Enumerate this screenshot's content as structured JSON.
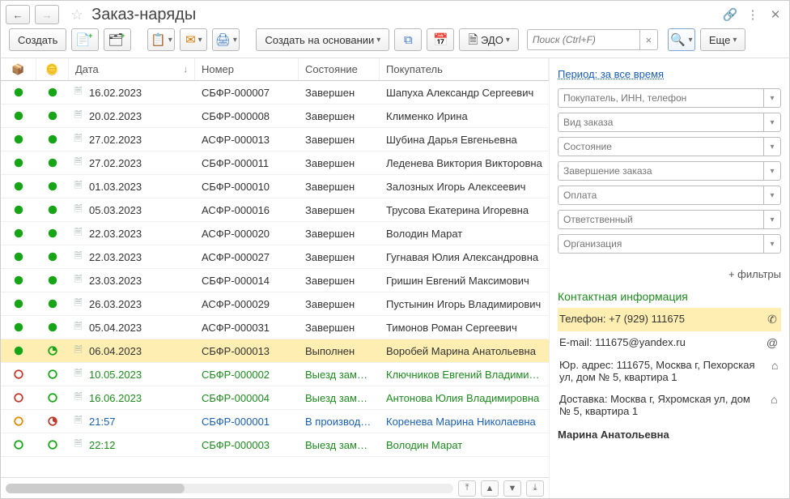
{
  "header": {
    "title": "Заказ-наряды"
  },
  "toolbar": {
    "create": "Создать",
    "create_based": "Создать на основании",
    "edo": "ЭДО",
    "search_placeholder": "Поиск (Ctrl+F)",
    "more": "Еще"
  },
  "table": {
    "columns": {
      "date": "Дата",
      "number": "Номер",
      "state": "Состояние",
      "buyer": "Покупатель"
    },
    "rows": [
      {
        "s1": "filled-green",
        "s2": "filled-green",
        "date": "16.02.2023",
        "num": "СБФР-000007",
        "state": "Завершен",
        "buyer": "Шапуха Александр Сергеевич"
      },
      {
        "s1": "filled-green",
        "s2": "filled-green",
        "date": "20.02.2023",
        "num": "СБФР-000008",
        "state": "Завершен",
        "buyer": "Клименко Ирина"
      },
      {
        "s1": "filled-green",
        "s2": "filled-green",
        "date": "27.02.2023",
        "num": "АСФР-000013",
        "state": "Завершен",
        "buyer": "Шубина Дарья Евгеньевна"
      },
      {
        "s1": "filled-green",
        "s2": "filled-green",
        "date": "27.02.2023",
        "num": "СБФР-000011",
        "state": "Завершен",
        "buyer": "Леденева Виктория Викторовна"
      },
      {
        "s1": "filled-green",
        "s2": "filled-green",
        "date": "01.03.2023",
        "num": "СБФР-000010",
        "state": "Завершен",
        "buyer": "Залозных Игорь Алексеевич"
      },
      {
        "s1": "filled-green",
        "s2": "filled-green",
        "date": "05.03.2023",
        "num": "АСФР-000016",
        "state": "Завершен",
        "buyer": "Трусова Екатерина Игоревна"
      },
      {
        "s1": "filled-green",
        "s2": "filled-green",
        "date": "22.03.2023",
        "num": "АСФР-000020",
        "state": "Завершен",
        "buyer": "Володин Марат"
      },
      {
        "s1": "filled-green",
        "s2": "filled-green",
        "date": "22.03.2023",
        "num": "АСФР-000027",
        "state": "Завершен",
        "buyer": "Гугнавая Юлия Александровна"
      },
      {
        "s1": "filled-green",
        "s2": "filled-green",
        "date": "23.03.2023",
        "num": "СБФР-000014",
        "state": "Завершен",
        "buyer": "Гришин Евгений Максимович"
      },
      {
        "s1": "filled-green",
        "s2": "filled-green",
        "date": "26.03.2023",
        "num": "АСФР-000029",
        "state": "Завершен",
        "buyer": "Пустынин Игорь Владимирович"
      },
      {
        "s1": "filled-green",
        "s2": "filled-green",
        "date": "05.04.2023",
        "num": "АСФР-000031",
        "state": "Завершен",
        "buyer": "Тимонов Роман Сергеевич"
      },
      {
        "s1": "filled-green",
        "s2": "pie-green",
        "date": "06.04.2023",
        "num": "СБФР-000013",
        "state": "Выполнен",
        "buyer": "Воробей Марина Анатольевна",
        "selected": true
      },
      {
        "s1": "ring-red",
        "s2": "ring-green",
        "date": "10.05.2023",
        "num": "СБФР-000002",
        "state": "Выезд заме…",
        "buyer": "Ключников Евгений Владимиров",
        "color": "green"
      },
      {
        "s1": "ring-red",
        "s2": "ring-green",
        "date": "16.06.2023",
        "num": "СБФР-000004",
        "state": "Выезд заме…",
        "buyer": "Антонова Юлия Владимировна",
        "color": "green"
      },
      {
        "s1": "ring-orange",
        "s2": "pie-red",
        "date": "21:57",
        "num": "СБФР-000001",
        "state": "В производ…",
        "buyer": "Коренева Марина Николаевна",
        "color": "blue"
      },
      {
        "s1": "ring-green",
        "s2": "ring-green",
        "date": "22:12",
        "num": "СБФР-000003",
        "state": "Выезд заме…",
        "buyer": "Володин Марат",
        "color": "green"
      }
    ]
  },
  "side": {
    "period_link": "Период: за все время",
    "filters": [
      {
        "placeholder": "Покупатель, ИНН, телефон"
      },
      {
        "placeholder": "Вид заказа"
      },
      {
        "placeholder": "Состояние"
      },
      {
        "placeholder": "Завершение заказа"
      },
      {
        "placeholder": "Оплата"
      },
      {
        "placeholder": "Ответственный"
      },
      {
        "placeholder": "Организация"
      }
    ],
    "more_filters": "+ фильтры",
    "contact_heading": "Контактная информация",
    "contacts": {
      "phone_label": "Телефон:",
      "phone_value": "+7 (929) 111675",
      "email_label": "E-mail:",
      "email_value": "111675@yandex.ru",
      "legal_label": "Юр. адрес:",
      "legal_value": "111675, Москва г, Пехорская ул, дом № 5, квартира 1",
      "delivery_label": "Доставка:",
      "delivery_value": "Москва г, Яхромская ул, дом № 5, квартира 1",
      "name": "Марина Анатольевна"
    }
  }
}
